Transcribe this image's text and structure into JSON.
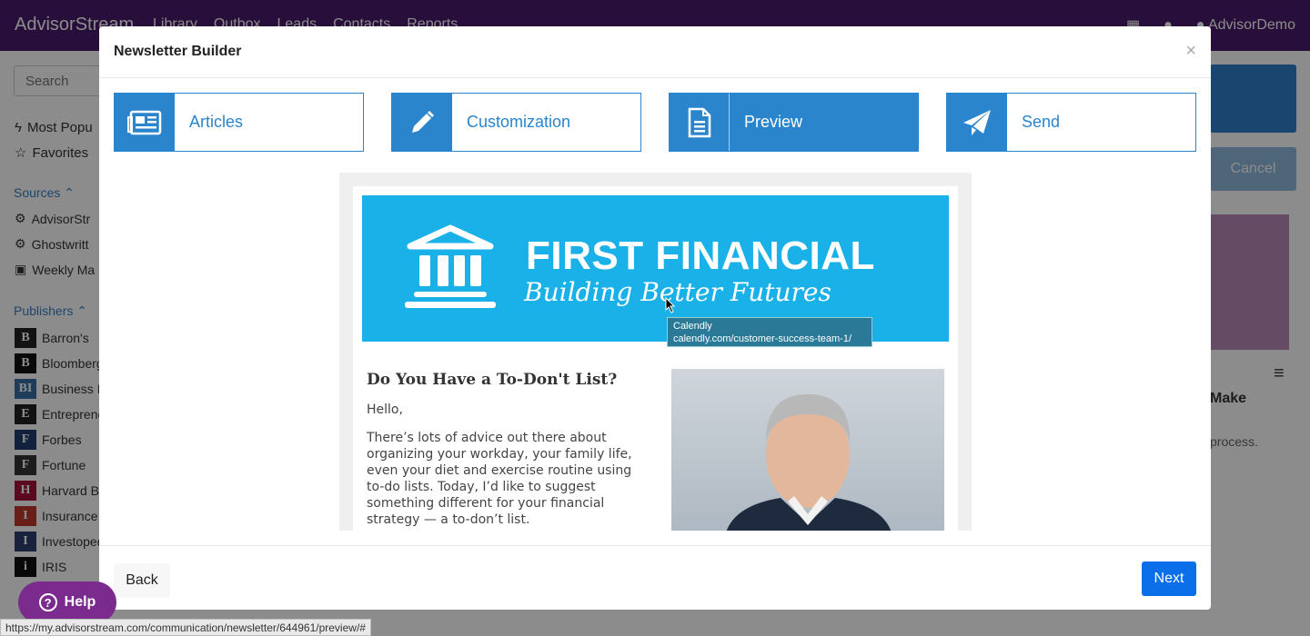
{
  "app": {
    "brand": "AdvisorStream",
    "nav": [
      "Library",
      "Outbox",
      "Leads",
      "Contacts",
      "Reports"
    ],
    "user": "AdvisorDemo"
  },
  "sidebar": {
    "search_placeholder": "Search",
    "quick": [
      "Most Popu",
      "Favorites"
    ],
    "sources_heading": "Sources",
    "sources": [
      "AdvisorStr",
      "Ghostwritt",
      "Weekly Ma"
    ],
    "publishers_heading": "Publishers",
    "publishers": [
      {
        "label": "Barron's",
        "icon": "B",
        "color": "#222222"
      },
      {
        "label": "Bloomberg",
        "icon": "B",
        "color": "#111111"
      },
      {
        "label": "Business I",
        "icon": "BI",
        "color": "#3a6ea5"
      },
      {
        "label": "Entreprene",
        "icon": "E",
        "color": "#222222"
      },
      {
        "label": "Forbes",
        "icon": "F",
        "color": "#1f3b6e"
      },
      {
        "label": "Fortune",
        "icon": "F",
        "color": "#333333"
      },
      {
        "label": "Harvard Bu",
        "icon": "H",
        "color": "#a5123a"
      },
      {
        "label": "Insurance",
        "icon": "I",
        "color": "#c0392b"
      },
      {
        "label": "Investoped",
        "icon": "I",
        "color": "#2c3e70"
      },
      {
        "label": "IRIS",
        "icon": "i",
        "color": "#111111"
      }
    ]
  },
  "right_panel": {
    "cancel": "Cancel",
    "heading_fragment": "Make",
    "text_fragment": "process."
  },
  "modal": {
    "title": "Newsletter Builder",
    "close": "×",
    "steps": [
      {
        "label": "Articles",
        "icon": "newspaper-icon",
        "active": false
      },
      {
        "label": "Customization",
        "icon": "pencil-icon",
        "active": false
      },
      {
        "label": "Preview",
        "icon": "document-icon",
        "active": true
      },
      {
        "label": "Send",
        "icon": "paper-plane-icon",
        "active": false
      }
    ],
    "preview": {
      "banner_title": "FIRST FINANCIAL",
      "banner_subtitle": "Building Better Futures",
      "article_title": "Do You Have a To-Don't List?",
      "greeting": "Hello,",
      "body": "There’s lots of advice out there about organizing your workday, your family life, even your diet and exercise routine using to-do lists. Today, I’d like to suggest something different for your financial strategy — a to-don’t list."
    },
    "tooltip": {
      "line1": "Calendly",
      "line2": "calendly.com/customer-success-team-1/"
    },
    "footer": {
      "back": "Back",
      "next": "Next"
    }
  },
  "help": {
    "label": "Help"
  },
  "status_url": "https://my.advisorstream.com/communication/newsletter/644961/preview/#",
  "colors": {
    "primary": "#2b85cc",
    "nav_bg": "#4a1a6b",
    "banner": "#1ab0e8",
    "next_button": "#0a6fe8",
    "help_button": "#7b2a8e"
  }
}
